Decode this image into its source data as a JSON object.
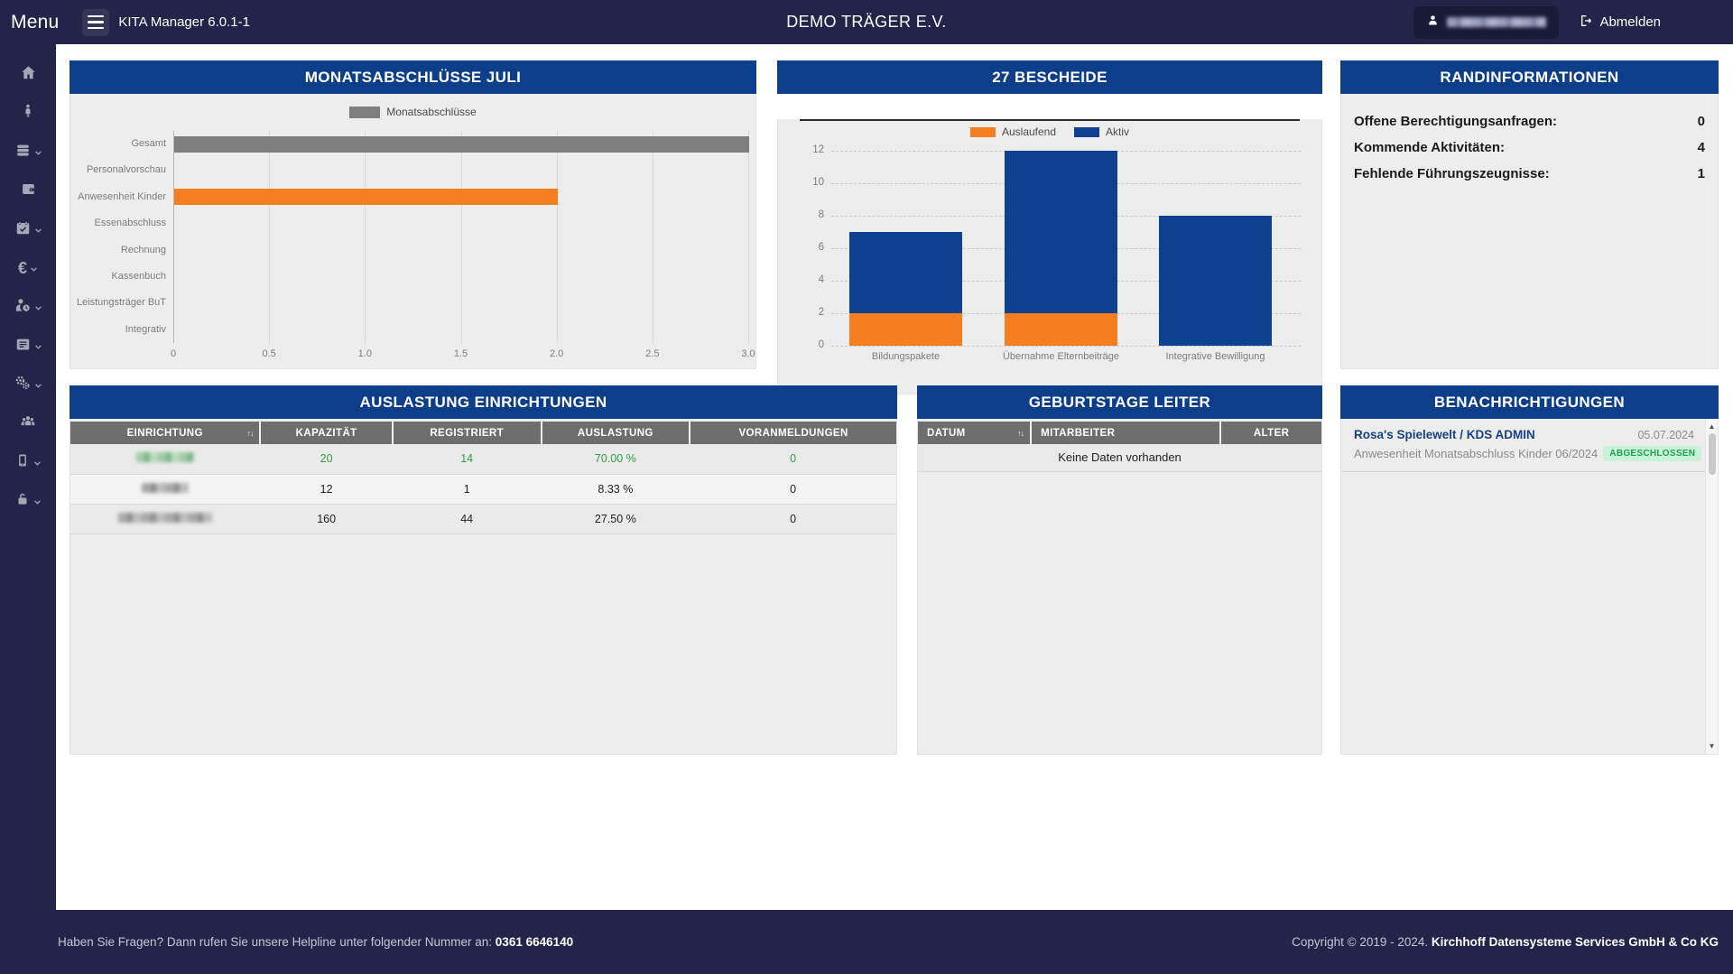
{
  "topbar": {
    "menu_label": "Menu",
    "app_title": "KITA Manager 6.0.1-1",
    "org_title": "DEMO TRÄGER E.V.",
    "logout_label": "Abmelden",
    "user_name_redacted": true
  },
  "sidebar": {
    "items": [
      {
        "icon": "home-icon",
        "expandable": false
      },
      {
        "icon": "child-icon",
        "expandable": false
      },
      {
        "icon": "stack-icon",
        "expandable": true
      },
      {
        "icon": "wallet-icon",
        "expandable": false
      },
      {
        "icon": "calendar-check-icon",
        "expandable": true
      },
      {
        "icon": "euro-icon",
        "expandable": true
      },
      {
        "icon": "user-clock-icon",
        "expandable": true
      },
      {
        "icon": "form-list-icon",
        "expandable": true
      },
      {
        "icon": "gears-icon",
        "expandable": true
      },
      {
        "icon": "users-group-icon",
        "expandable": false
      },
      {
        "icon": "mobile-icon",
        "expandable": true
      },
      {
        "icon": "lock-icon",
        "expandable": true
      }
    ]
  },
  "chart_data": [
    {
      "id": "monatsabschluesse",
      "type": "bar",
      "orientation": "horizontal",
      "title": "MONATSABSCHLÜSSE JULI",
      "legend": [
        {
          "label": "Monatsabschlüsse",
          "color": "#7f7f7f"
        }
      ],
      "legend_position": "top-center",
      "grid": true,
      "categories": [
        "Gesamt",
        "Personalvorschau",
        "Anwesenheit Kinder",
        "Essenabschluss",
        "Rechnung",
        "Kassenbuch",
        "Leistungsträger BuT",
        "Integrativ"
      ],
      "values": [
        3,
        0,
        2,
        0,
        0,
        0,
        0,
        0
      ],
      "bar_colors": [
        "#7f7f7f",
        "#7f7f7f",
        "#f57e20",
        "#7f7f7f",
        "#7f7f7f",
        "#7f7f7f",
        "#7f7f7f",
        "#7f7f7f"
      ],
      "xlim": [
        0,
        3
      ],
      "xticks": [
        0,
        0.5,
        1,
        1.5,
        2,
        2.5,
        3
      ],
      "xtick_labels": [
        "0",
        "0.5",
        "1.0",
        "1.5",
        "2.0",
        "2.5",
        "3.0"
      ]
    },
    {
      "id": "bescheide",
      "type": "bar",
      "stacked": true,
      "title": "27 BESCHEIDE",
      "legend_position": "top-center",
      "grid": true,
      "categories": [
        "Bildungspakete",
        "Übernahme Elternbeiträge",
        "Integrative Bewilligung"
      ],
      "series": [
        {
          "name": "Auslaufend",
          "color": "#f57e20",
          "values": [
            2,
            2,
            0
          ]
        },
        {
          "name": "Aktiv",
          "color": "#0e4190",
          "values": [
            5,
            10,
            8
          ]
        }
      ],
      "totals": [
        7,
        12,
        8
      ],
      "ylim": [
        0,
        12
      ],
      "yticks": [
        0,
        2,
        4,
        6,
        8,
        10,
        12
      ]
    }
  ],
  "randinformationen": {
    "title": "RANDINFORMATIONEN",
    "rows": [
      {
        "label": "Offene Berechtigungsanfragen:",
        "value": "0"
      },
      {
        "label": "Kommende Aktivitäten:",
        "value": "4"
      },
      {
        "label": "Fehlende Führungszeugnisse:",
        "value": "1"
      }
    ]
  },
  "auslastung": {
    "title": "AUSLASTUNG EINRICHTUNGEN",
    "columns": [
      "EINRICHTUNG",
      "KAPAZITÄT",
      "REGISTRIERT",
      "AUSLASTUNG",
      "VORANMELDUNGEN"
    ],
    "rows": [
      {
        "einrichtung_redacted": true,
        "kapazitaet": "20",
        "registriert": "14",
        "auslastung": "70.00 %",
        "voranmeldungen": "0",
        "highlight": "green"
      },
      {
        "einrichtung_redacted": true,
        "kapazitaet": "12",
        "registriert": "1",
        "auslastung": "8.33 %",
        "voranmeldungen": "0",
        "highlight": ""
      },
      {
        "einrichtung_redacted": true,
        "kapazitaet": "160",
        "registriert": "44",
        "auslastung": "27.50 %",
        "voranmeldungen": "0",
        "highlight": ""
      }
    ]
  },
  "geburtstage": {
    "title": "GEBURTSTAGE LEITER",
    "columns": [
      "DATUM",
      "MITARBEITER",
      "ALTER"
    ],
    "empty_text": "Keine Daten vorhanden"
  },
  "benachrichtigungen": {
    "title": "BENACHRICHTIGUNGEN",
    "items": [
      {
        "title": "Rosa's Spielewelt / KDS ADMIN",
        "date": "05.07.2024",
        "text": "Anwesenheit Monatsabschluss Kinder 06/2024",
        "badge": "ABGESCHLOSSEN"
      }
    ]
  },
  "footer": {
    "help_text": "Haben Sie Fragen? Dann rufen Sie unsere Helpline unter folgender Nummer an:",
    "phone": "0361 6646140",
    "copyright": "Copyright © 2019 - 2024.",
    "company": "Kirchhoff Datensysteme Services GmbH & Co KG"
  },
  "icons": {
    "sort": "↑↓",
    "scroll_up": "▲",
    "scroll_down": "▼"
  },
  "colors": {
    "navy": "#222549",
    "panel_header_blue": "#0d3e8a",
    "orange": "#f57e20",
    "chart_blue": "#0e4190",
    "bar_gray": "#7f7f7f",
    "green_text": "#2f9e44",
    "badge_bg": "#c9f3d6",
    "badge_text": "#1d9e57",
    "table_header_gray": "#6e6e6e"
  }
}
